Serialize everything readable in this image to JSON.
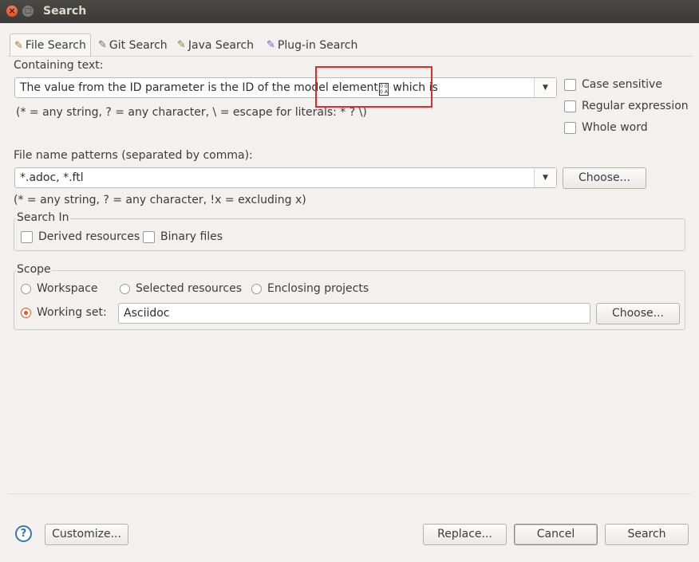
{
  "window": {
    "title": "Search"
  },
  "tabs": [
    {
      "label": "File Search",
      "active": true
    },
    {
      "label": "Git Search"
    },
    {
      "label": "Java Search"
    },
    {
      "label": "Plug-in Search"
    }
  ],
  "containing_text": {
    "label": "Containing text:",
    "value_before": "The value from the ID parameter is the ID of the model element",
    "value_after": " which is",
    "hint": "(* = any string, ? = any character, \\ = escape for literals: * ? \\)"
  },
  "options": {
    "case_sensitive": "Case sensitive",
    "regular_expression": "Regular expression",
    "whole_word": "Whole word"
  },
  "file_patterns": {
    "label": "File name patterns (separated by comma):",
    "value": "*.adoc, *.ftl",
    "choose": "Choose...",
    "hint": "(* = any string, ? = any character, !x = excluding x)"
  },
  "search_in": {
    "title": "Search In",
    "derived": "Derived resources",
    "binary": "Binary files"
  },
  "scope": {
    "title": "Scope",
    "workspace": "Workspace",
    "selected": "Selected resources",
    "enclosing": "Enclosing projects",
    "working_set": "Working set:",
    "working_set_value": "Asciidoc",
    "choose": "Choose..."
  },
  "footer": {
    "customize": "Customize...",
    "replace": "Replace...",
    "cancel": "Cancel",
    "search": "Search"
  },
  "colors": {
    "accent": "#e05a24",
    "highlight_box": "#e12a2a"
  }
}
